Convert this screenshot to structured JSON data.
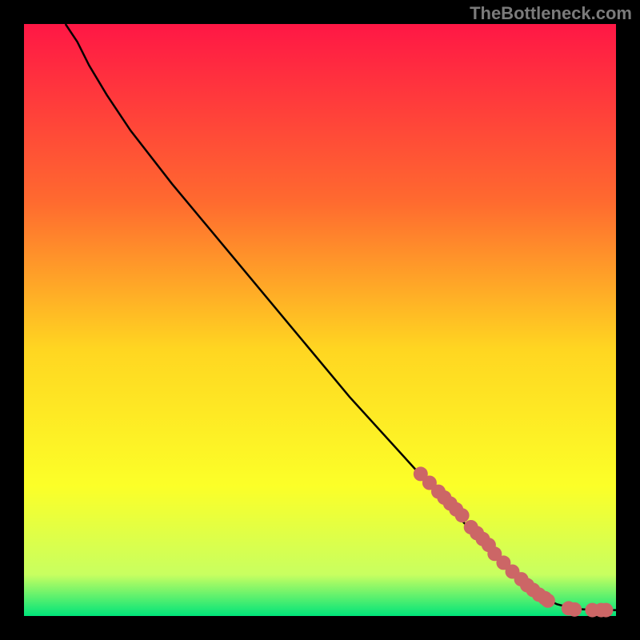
{
  "attribution": "TheBottleneck.com",
  "chart_data": {
    "type": "line",
    "title": "",
    "xlabel": "",
    "ylabel": "",
    "xlim": [
      0,
      100
    ],
    "ylim": [
      0,
      100
    ],
    "gradient_colors": {
      "top": "#ff1745",
      "upper_mid": "#ff6a2f",
      "mid": "#ffd621",
      "lower_mid": "#fcff28",
      "near_bottom": "#c8ff60",
      "bottom": "#00e47a"
    },
    "series": [
      {
        "name": "curve",
        "x": [
          7,
          9,
          11,
          14,
          18,
          25,
          35,
          45,
          55,
          65,
          75,
          82,
          86,
          88,
          90,
          93,
          97,
          100
        ],
        "y": [
          100,
          97,
          93,
          88,
          82,
          73,
          61,
          49,
          37,
          26,
          15,
          8,
          4.5,
          3,
          2,
          1.2,
          1,
          1
        ]
      },
      {
        "name": "points",
        "x": [
          67,
          68.5,
          70,
          71,
          72,
          73,
          74,
          75.5,
          76.5,
          77.5,
          78.5,
          79.5,
          81,
          82.5,
          84,
          85,
          86,
          87,
          88,
          88.5,
          92,
          93,
          96,
          97.5,
          98.3
        ],
        "y": [
          24,
          22.5,
          21,
          20,
          19,
          18,
          17,
          15,
          14,
          13,
          12,
          10.5,
          9,
          7.5,
          6.2,
          5.2,
          4.4,
          3.6,
          3,
          2.6,
          1.3,
          1.1,
          1,
          1,
          1
        ]
      }
    ],
    "point_color": "#cc6666",
    "curve_color": "#000000"
  }
}
